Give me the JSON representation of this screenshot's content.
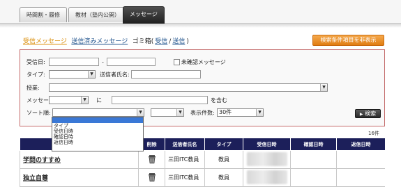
{
  "tabs": [
    {
      "label": "時間割・履修",
      "active": false
    },
    {
      "label": "教材（塾内公開）",
      "active": false
    },
    {
      "label": "メッセージ",
      "active": true
    }
  ],
  "subnav": {
    "received": "受信メッセージ",
    "sent": "送信済みメッセージ",
    "trash_prefix": "ゴミ箱(",
    "trash_received": "受信",
    "trash_sep": "/",
    "trash_sent": "送信",
    "trash_suffix": ")"
  },
  "hide_button": "検索条件項目を非表示",
  "search": {
    "received_date_label": "受信日:",
    "date_sep": "-",
    "unconfirmed_label": "未確認メッセージ",
    "type_label": "タイプ:",
    "sender_label": "送信者氏名:",
    "course_label": "授業:",
    "message_label": "メッセージ:",
    "ni_label": "に",
    "contains_label": "を含む",
    "sort_label": "ソート順:",
    "display_count_label": "表示件数:",
    "display_count_value": "30件",
    "search_button": "検索"
  },
  "sort_dropdown": {
    "options": [
      "",
      "タイプ",
      "受信日時",
      "確認日時",
      "返信日時"
    ],
    "selected_index": 0
  },
  "result_count": "16件",
  "table": {
    "headers": [
      "",
      "削除",
      "送信者氏名",
      "タイプ",
      "受信日時",
      "確認日時",
      "返信日時"
    ],
    "rows": [
      {
        "title": "学問のすすめ",
        "sender": "三田ITC教員",
        "type": "教員"
      },
      {
        "title": "独立自尊",
        "sender": "三田ITC教員",
        "type": "教員"
      }
    ]
  },
  "colors": {
    "tab_active": "#1e1e1e",
    "link_active": "#d98a00",
    "link": "#1a4f8a",
    "orange_button": "#e07d12",
    "table_header": "#1c1f5a",
    "search_border": "#c46a6a",
    "dropdown_selected": "#3a78d6"
  }
}
